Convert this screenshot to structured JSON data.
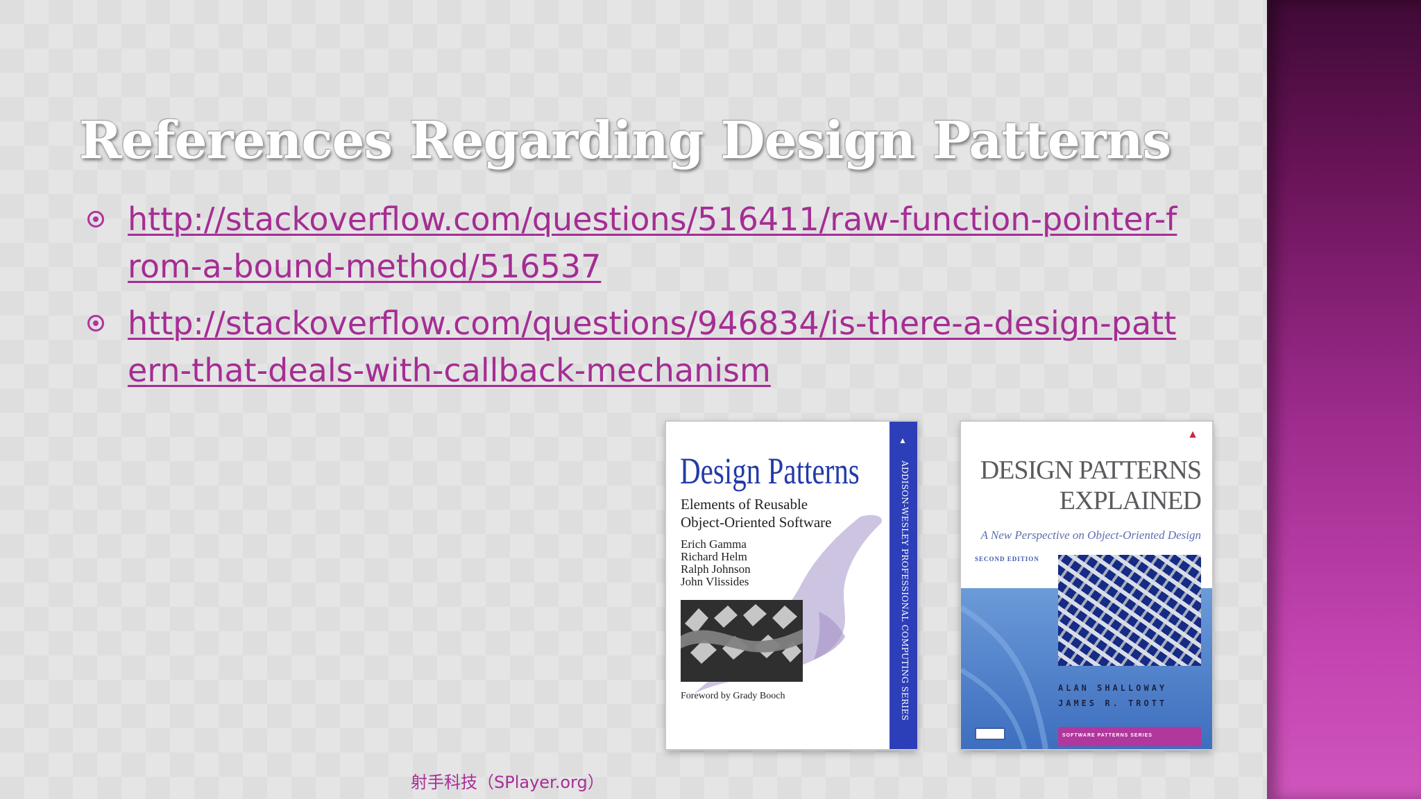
{
  "slide": {
    "title": "References Regarding Design Patterns",
    "links": [
      {
        "text": "http://stackoverflow.com/questions/516411/raw-function-pointer-from-a-bound-method/516537"
      },
      {
        "text": "http://stackoverflow.com/questions/946834/is-there-a-design-pattern-that-deals-with-callback-mechanism"
      }
    ]
  },
  "covers": {
    "book1": {
      "title": "Design Patterns",
      "subtitle_line1": "Elements of Reusable",
      "subtitle_line2": "Object-Oriented Software",
      "authors": [
        "Erich Gamma",
        "Richard Helm",
        "Ralph Johnson",
        "John Vlissides"
      ],
      "foreword": "Foreword by Grady Booch",
      "spine_text": "ADDISON-WESLEY PROFESSIONAL COMPUTING SERIES"
    },
    "book2": {
      "title_line1": "DESIGN PATTERNS",
      "title_line2": "EXPLAINED",
      "subtitle": "A New Perspective on Object-Oriented Design",
      "edition": "SECOND EDITION",
      "authors": [
        "ALAN SHALLOWAY",
        "JAMES R. TROTT"
      ],
      "series": "SOFTWARE PATTERNS SERIES"
    }
  },
  "watermark": {
    "text": "射手科技（SPlayer.org）"
  },
  "colors": {
    "link": "#a52d93",
    "bullet": "#b0349d",
    "title": "#ffffff",
    "accent_panel": "#9d2b8c"
  },
  "icons": {
    "bullet": "circle-bullet-icon"
  }
}
